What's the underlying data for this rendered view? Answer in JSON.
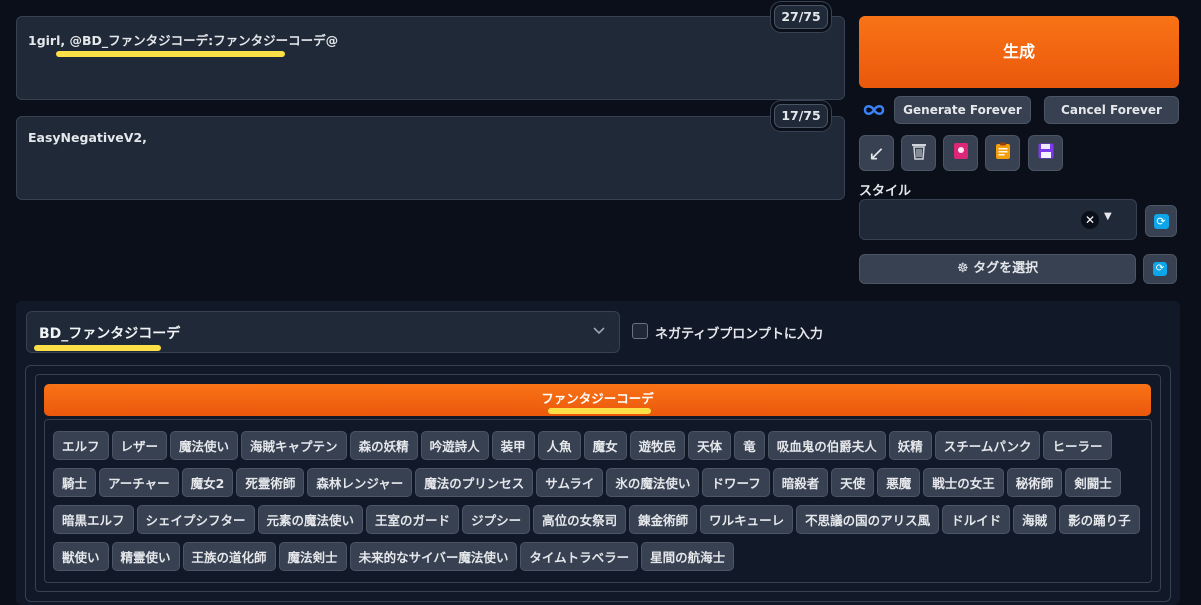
{
  "prompt": {
    "text": "1girl, @BD_ファンタジコーデ:ファンタジーコーデ@",
    "counter": "27/75"
  },
  "negative_prompt": {
    "text": "EasyNegativeV2,",
    "counter": "17/75"
  },
  "actions": {
    "generate": "生成",
    "generate_forever": "Generate Forever",
    "cancel_forever": "Cancel Forever"
  },
  "tools": [
    {
      "icon": "arrow-icon",
      "glyph": "↙",
      "color": "#e5e7eb"
    },
    {
      "icon": "trash-icon",
      "glyph": "🗑",
      "color": "#d1d5db"
    },
    {
      "icon": "red-card-icon",
      "glyph": "▣",
      "color": "#db2777"
    },
    {
      "icon": "clipboard-icon",
      "glyph": "📋",
      "color": "#f59e0b"
    },
    {
      "icon": "save-icon",
      "glyph": "💾",
      "color": "#7c3aed"
    }
  ],
  "style": {
    "label": "スタイル",
    "value": ""
  },
  "tag_select": {
    "label": "☸ タグを選択"
  },
  "wildcard": {
    "selected": "BD_ファンタジコーデ",
    "negative_checkbox_label": "ネガティブプロンプトに入力",
    "negative_checked": false
  },
  "category": {
    "title": "ファンタジーコーデ"
  },
  "tag_rows": [
    [
      "エルフ",
      "レザー",
      "魔法使い",
      "海賊キャプテン",
      "森の妖精",
      "吟遊詩人",
      "装甲",
      "人魚",
      "魔女",
      "遊牧民",
      "天体",
      "竜",
      "吸血鬼の伯爵夫人",
      "妖精",
      "スチームパンク",
      "ヒーラー"
    ],
    [
      "騎士",
      "アーチャー",
      "魔女2",
      "死霊術師",
      "森林レンジャー",
      "魔法のプリンセス",
      "サムライ",
      "氷の魔法使い",
      "ドワーフ",
      "暗殺者",
      "天使",
      "悪魔",
      "戦士の女王",
      "秘術師",
      "剣闘士"
    ],
    [
      "暗黒エルフ",
      "シェイプシフター",
      "元素の魔法使い",
      "王室のガード",
      "ジプシー",
      "高位の女祭司",
      "錬金術師",
      "ワルキューレ",
      "不思議の国のアリス風",
      "ドルイド",
      "海賊",
      "影の踊り子"
    ],
    [
      "獣使い",
      "精霊使い",
      "王族の道化師",
      "魔法剣士",
      "未来的なサイバー魔法使い",
      "タイムトラベラー",
      "星間の航海士"
    ]
  ]
}
